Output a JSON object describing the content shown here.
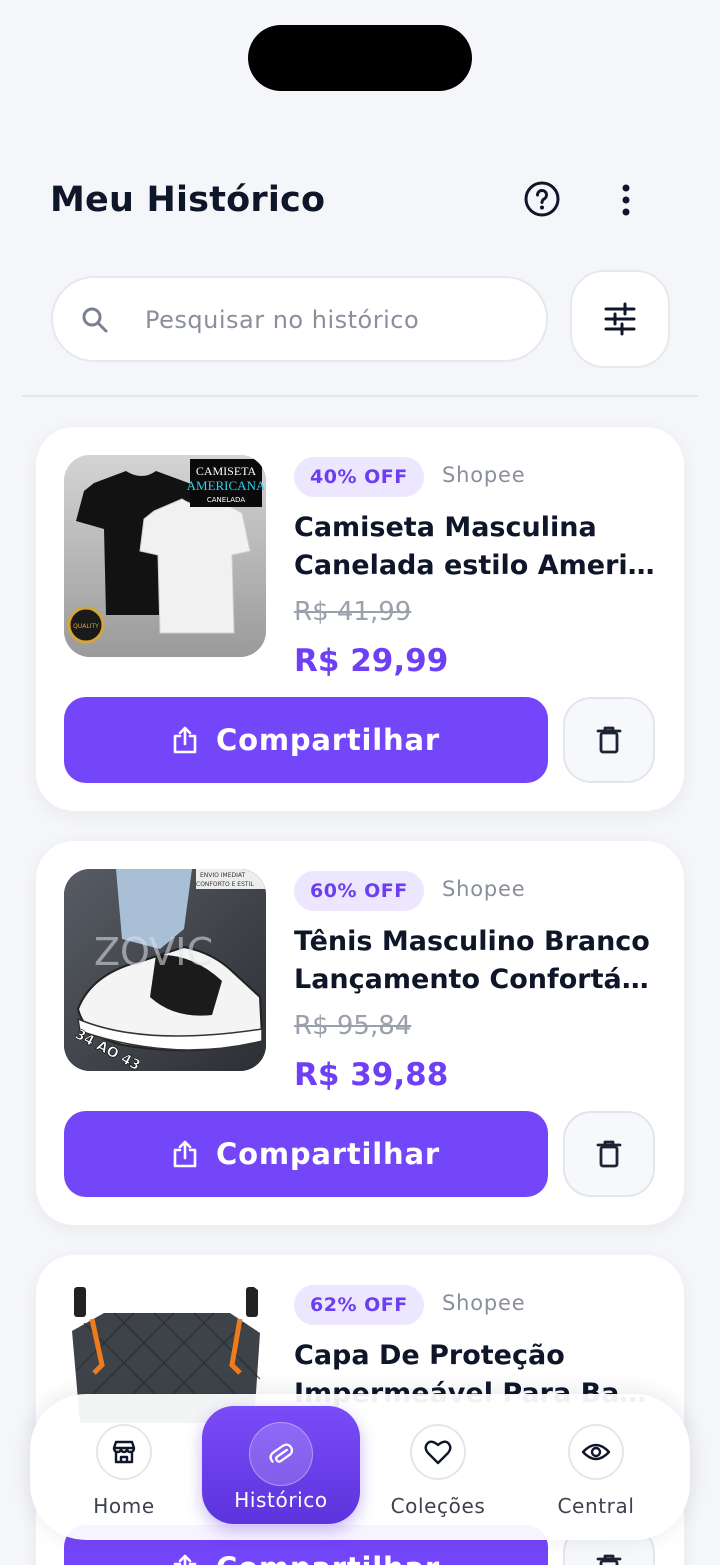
{
  "header": {
    "title": "Meu Histórico",
    "help_icon": "help-circle-icon",
    "menu_icon": "more-vertical-icon"
  },
  "search": {
    "placeholder": "Pesquisar no histórico",
    "value": "",
    "icon": "search-icon",
    "filter_icon": "sliders-icon"
  },
  "products": [
    {
      "discount": "40% OFF",
      "store": "Shopee",
      "title_line1": "Camiseta Masculina",
      "title_line2": "Canelada estilo Americana",
      "old_price": "R$ 41,99",
      "new_price": "R$ 29,99",
      "image_label_line1": "CAMISETA",
      "image_label_line2": "AMERICANA",
      "image_label_line3": "CANELADA",
      "image_seal": "QUALITY",
      "share_label": "Compartilhar",
      "delete_icon": "trash-icon"
    },
    {
      "discount": "60% OFF",
      "store": "Shopee",
      "title_line1": "Tênis Masculino Branco",
      "title_line2": "Lançamento Confortável",
      "old_price": "R$ 95,84",
      "new_price": "R$ 39,88",
      "image_label_line1": "ENVIO IMEDIAT",
      "image_label_line2": "CONFORTO E ESTIL",
      "image_brand": "ZOVIC",
      "image_sizes": "34 AO 43",
      "share_label": "Compartilhar",
      "delete_icon": "trash-icon"
    },
    {
      "discount": "62% OFF",
      "store": "Shopee",
      "title_line1": "Capa De Proteção",
      "title_line2": "Impermeável Para Banco",
      "share_label": "Compartilhar",
      "delete_icon": "trash-icon"
    }
  ],
  "bottom_nav": {
    "items": [
      {
        "label": "Home",
        "icon": "store-icon",
        "active": false
      },
      {
        "label": "Histórico",
        "icon": "paperclip-icon",
        "active": true
      },
      {
        "label": "Coleções",
        "icon": "heart-icon",
        "active": false
      },
      {
        "label": "Central",
        "icon": "eye-icon",
        "active": false
      }
    ]
  },
  "colors": {
    "accent": "#7446fa",
    "badge_bg": "#ede6ff",
    "price": "#6f3ff5",
    "background": "#f5f6f9"
  }
}
